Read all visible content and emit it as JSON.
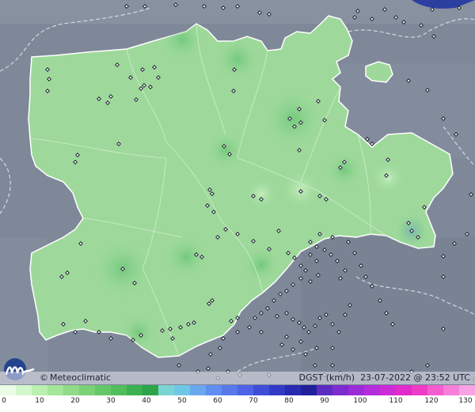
{
  "map": {
    "brand": {
      "copyright_symbol": "©",
      "name": "Meteoclimatic"
    },
    "parameter_label": "DGST (km/h)",
    "timestamp": "23-07-2022 @ 23:52 UTC",
    "logo_icon": "meteoclimatic-m-logo",
    "colors": {
      "background_terrain": "#7f8898",
      "region_fill": "#9ed99b",
      "region_border": "#ffffff",
      "station_marker": "#1e2330",
      "logo_circle": "#1d3f8e"
    }
  },
  "scale": {
    "unit": "km/h",
    "labels": [
      "0",
      "10",
      "20",
      "30",
      "40",
      "50",
      "60",
      "70",
      "80",
      "90",
      "100",
      "110",
      "120",
      "130"
    ],
    "colors": [
      "#e8fde4",
      "#d2f8cb",
      "#bbf0b1",
      "#a4e69a",
      "#8fdb87",
      "#7ad176",
      "#64c868",
      "#51be5c",
      "#3bb151",
      "#2ea449",
      "#7bd4d2",
      "#6fc7e6",
      "#6aa8ee",
      "#5f8ff0",
      "#5779ec",
      "#4e63e5",
      "#3f4dd8",
      "#3239c6",
      "#2a2ab0",
      "#20209a",
      "#5a2cc2",
      "#7c2ccf",
      "#9a2cd8",
      "#b52cdb",
      "#cc2cd5",
      "#e02ccb",
      "#ee3cc6",
      "#f45ccf",
      "#f77fd9",
      "#f9a2e3"
    ]
  }
}
